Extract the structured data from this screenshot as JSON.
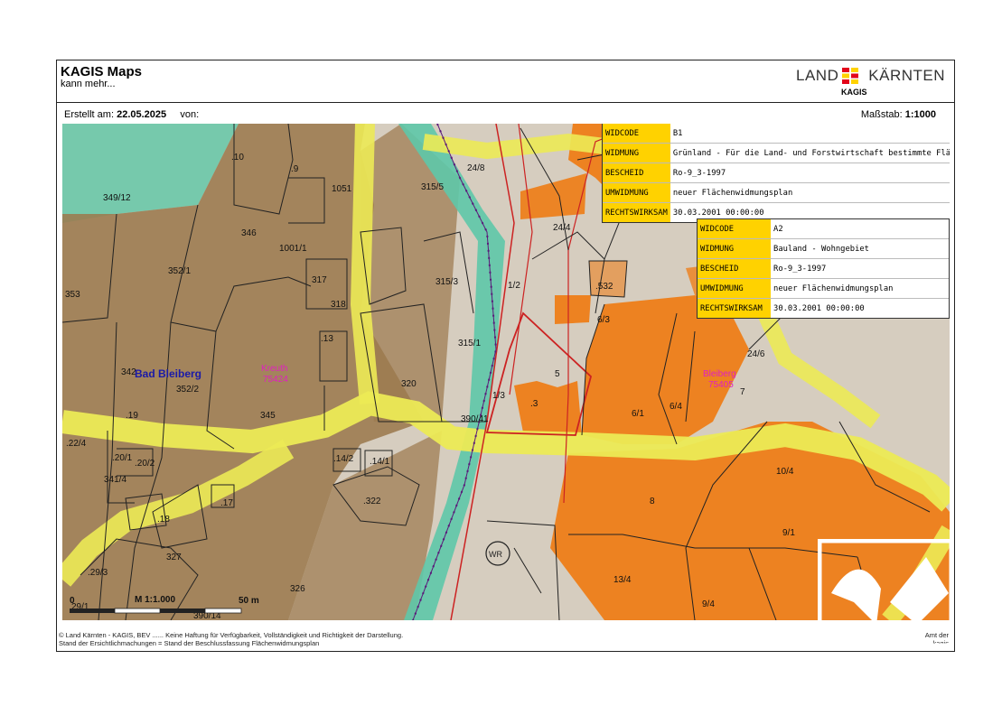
{
  "header": {
    "title": "KAGIS Maps",
    "subtitle": "kann mehr...",
    "logo": {
      "land": "LAND",
      "kaernten": "KÄRNTEN",
      "kagis": "KAGIS",
      "mark_colors": [
        "#e3051b",
        "#ffd200"
      ]
    },
    "created_label": "Erstellt am:",
    "created_date": "22.05.2025",
    "by_label": "von:",
    "scale_label": "Maßstab:",
    "scale_value": "1:1000"
  },
  "info_boxes": [
    {
      "rows": [
        {
          "key": "WIDCODE",
          "value": "B1"
        },
        {
          "key": "WIDMUNG",
          "value": "Grünland - Für die Land- und Forstwirtschaft bestimmte Fläche, Ödland"
        },
        {
          "key": "BESCHEID",
          "value": "Ro-9_3-1997"
        },
        {
          "key": "UMWIDMUNG",
          "value": "neuer Flächenwidmungsplan"
        },
        {
          "key": "RECHTSWIRKSAM",
          "value": "30.03.2001 00:00:00"
        }
      ]
    },
    {
      "rows": [
        {
          "key": "WIDCODE",
          "value": "A2"
        },
        {
          "key": "WIDMUNG",
          "value": "Bauland - Wohngebiet"
        },
        {
          "key": "BESCHEID",
          "value": "Ro-9_3-1997"
        },
        {
          "key": "UMWIDMUNG",
          "value": "neuer Flächenwidmungsplan"
        },
        {
          "key": "RECHTSWIRKSAM",
          "value": "30.03.2001 00:00:00"
        }
      ]
    }
  ],
  "map": {
    "colors": {
      "grundland": "#9c7a4f",
      "bauland": "#ef7a10",
      "road": "#ecea55",
      "river": "#5ec8a8",
      "bg": "#d8cfc2"
    },
    "place_labels": [
      {
        "text": "Bad Bleiberg",
        "color": "#1a1aa8"
      },
      {
        "text": "Kreuth",
        "color": "#e020c0"
      },
      {
        "text": "75424",
        "color": "#e020c0"
      },
      {
        "text": "Bleiberg",
        "color": "#e020c0"
      },
      {
        "text": "75405",
        "color": "#e020c0"
      }
    ],
    "parcels": [
      ".10",
      ".9",
      "1051",
      "349/12",
      "346",
      "1001/1",
      "352/1",
      "317",
      "318",
      "353",
      ".13",
      "342",
      "352/2",
      "320",
      ".19",
      "345",
      ".22/4",
      ".20/1",
      ".20/2",
      "341/4",
      ".14/2",
      ".14/1",
      ".17",
      ".322",
      ".18",
      "327",
      ".29/3",
      "326",
      "29/1",
      "390/14",
      "315/5",
      "315/3",
      "315/1",
      "24/8",
      "1/2",
      "24/4",
      ".532",
      "6/3",
      "5",
      "1/3",
      ".3",
      "390/41",
      "6/1",
      "6/4",
      "7",
      "24/6",
      "10/4",
      "8",
      "9/1",
      "13/4",
      "9/4"
    ],
    "wr_symbol": "WR",
    "scalebar": {
      "start": "0",
      "ratio": "M 1:1.000",
      "end": "50 m"
    }
  },
  "footer": {
    "line1": "© Land Kärnten - KAGIS, BEV ...... Keine Haftung für Verfügbarkeit, Vollständigkeit und Richtigkeit der Darstellung.",
    "line2": "Stand der Ersichtlichmachungen = Stand der Beschlussfassung Flächenwidmungsplan",
    "right1": "Amt der",
    "right2": "kagis"
  }
}
